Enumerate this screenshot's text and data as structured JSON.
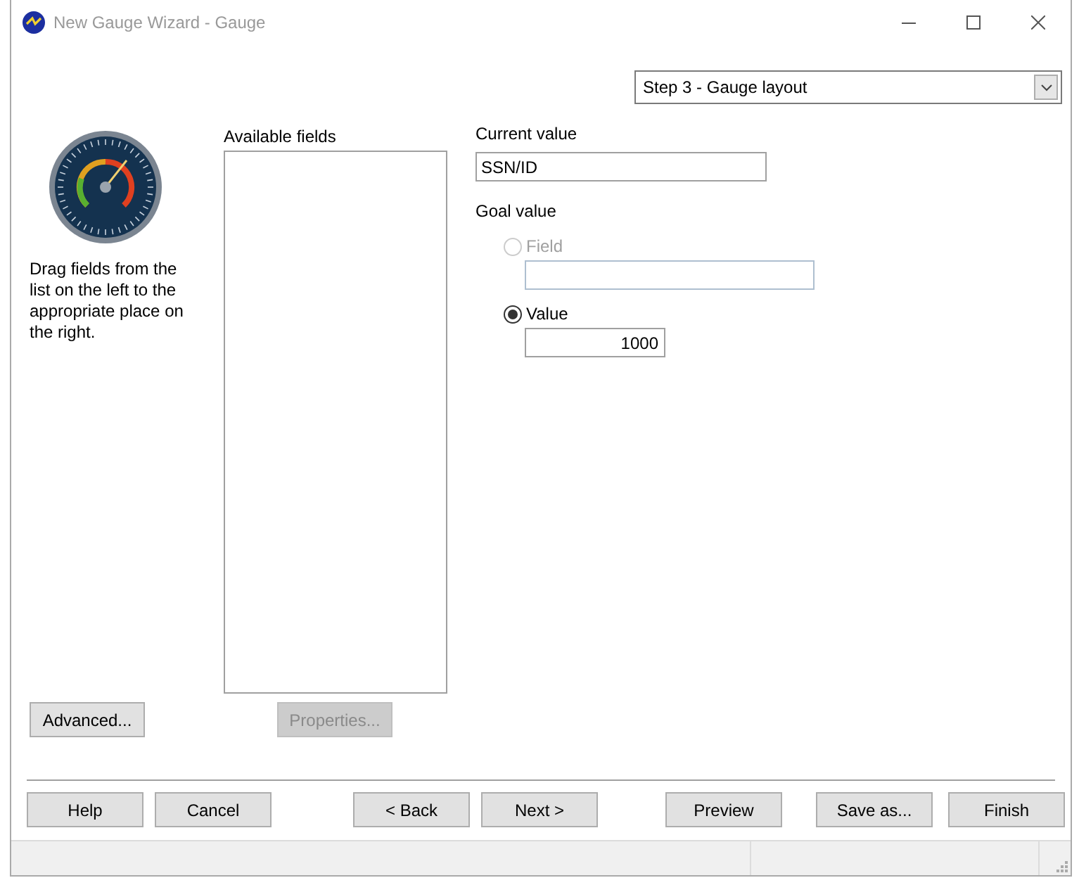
{
  "window": {
    "title": "New Gauge Wizard - Gauge"
  },
  "step_dropdown": {
    "value": "Step 3 - Gauge layout"
  },
  "instructions": "Drag fields from the list on the left to the appropriate place on the right.",
  "available_fields": {
    "label": "Available fields"
  },
  "advanced_button": {
    "label": "Advanced...",
    "disabled": false
  },
  "properties_button": {
    "label": "Properties...",
    "disabled": true
  },
  "current_value": {
    "label": "Current value",
    "value": "SSN/ID"
  },
  "goal_value": {
    "label": "Goal value",
    "options": [
      {
        "label": "Field",
        "selected": false,
        "disabled": true
      },
      {
        "label": "Value",
        "selected": true,
        "disabled": false,
        "value": "1000"
      }
    ]
  },
  "buttons": {
    "left": [
      {
        "label": "Help"
      },
      {
        "label": "Cancel"
      }
    ],
    "nav": [
      {
        "label": "< Back"
      },
      {
        "label": "Next >"
      }
    ],
    "right": [
      {
        "label": "Preview"
      },
      {
        "label": "Save as..."
      },
      {
        "label": "Finish"
      }
    ]
  }
}
